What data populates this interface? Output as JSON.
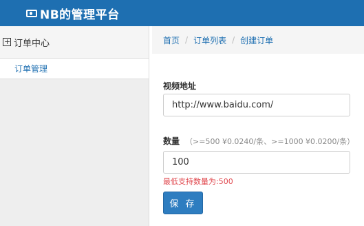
{
  "header": {
    "brand_icon": "money-bill-icon",
    "title": "NB的管理平台"
  },
  "sidebar": {
    "group": {
      "icon": "calendar-plus-icon",
      "label": "订单中心"
    },
    "items": [
      {
        "label": "订单管理"
      }
    ]
  },
  "breadcrumb": {
    "items": [
      "首页",
      "订单列表",
      "创建订单"
    ],
    "separator": "/"
  },
  "form": {
    "url_label": "视频地址",
    "url_value": "http://www.baidu.com/",
    "qty_label": "数量",
    "qty_hint": "（>=500 ¥0.0240/条、>=1000 ¥0.0200/条）",
    "qty_value": "100",
    "error": "最低支持数量为:500",
    "save_label": "保 存"
  },
  "colors": {
    "header_bg": "#1e6fb1",
    "primary": "#2e7dc0",
    "error": "#e0484e"
  }
}
